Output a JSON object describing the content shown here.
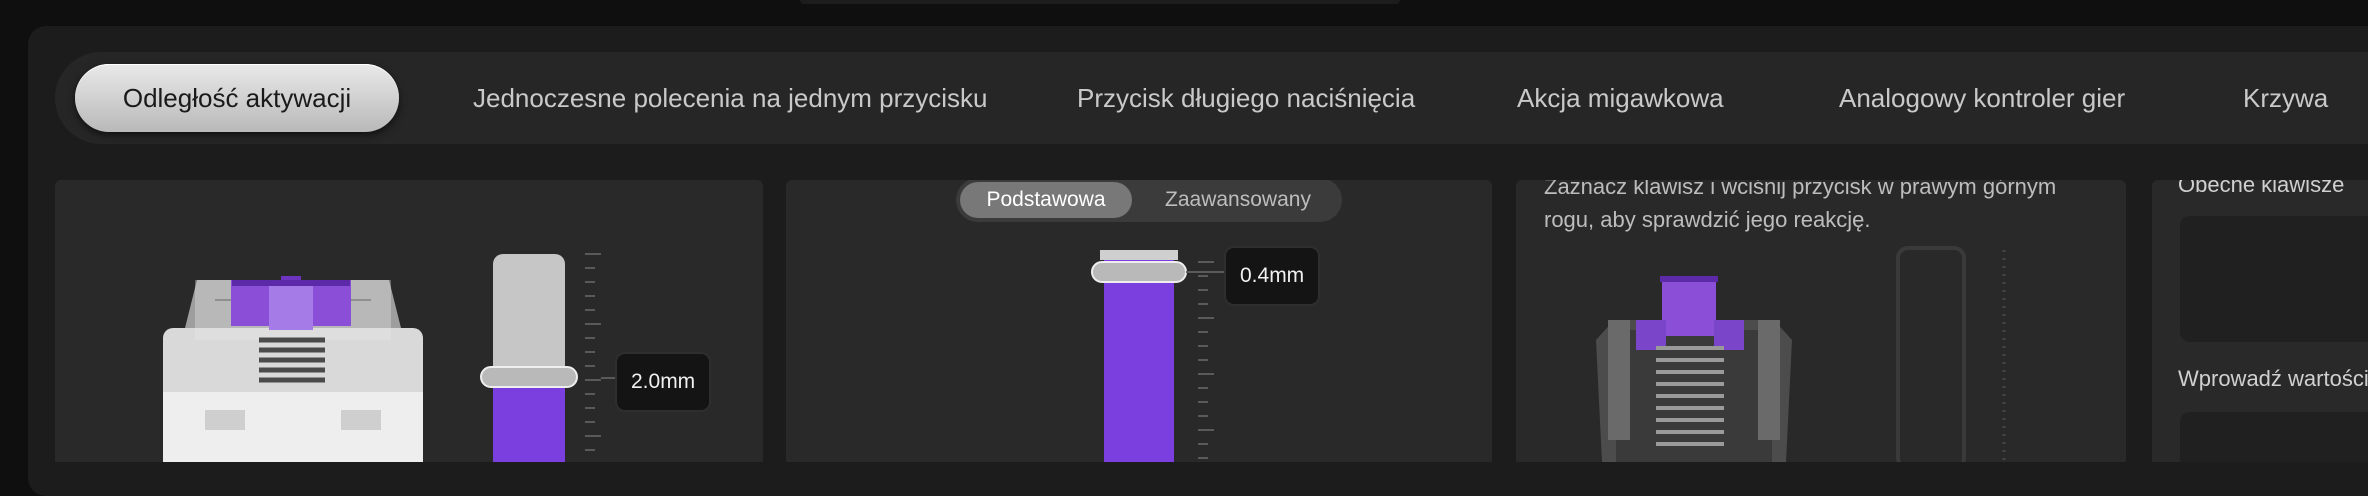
{
  "tabs": [
    {
      "label": "Odległość aktywacji",
      "active": true
    },
    {
      "label": "Jednoczesne polecenia na jednym przycisku",
      "active": false
    },
    {
      "label": "Przycisk długiego naciśnięcia",
      "active": false
    },
    {
      "label": "Akcja migawkowa",
      "active": false
    },
    {
      "label": "Analogowy kontroler gier",
      "active": false
    },
    {
      "label": "Krzywa",
      "active": false
    }
  ],
  "actuation_card": {
    "value_label": "2.0mm",
    "slider_fraction": 0.5
  },
  "rapid_trigger_card": {
    "mode_basic": "Podstawowa",
    "mode_advanced": "Zaawansowany",
    "selected_mode": "Podstawowa",
    "value_label": "0.4mm"
  },
  "test_card": {
    "description": "Zaznacz klawisz i wciśnij przycisk w prawym górnym rogu, aby sprawdzić jego reakcję."
  },
  "side_panel": {
    "current_keys_label": "Obecne klawisze",
    "enter_value_label": "Wprowadź wartości"
  },
  "colors": {
    "accent_purple": "#7b3fe0",
    "switch_stem": "#8a4fd6",
    "active_tab": "#d8d8d8"
  }
}
